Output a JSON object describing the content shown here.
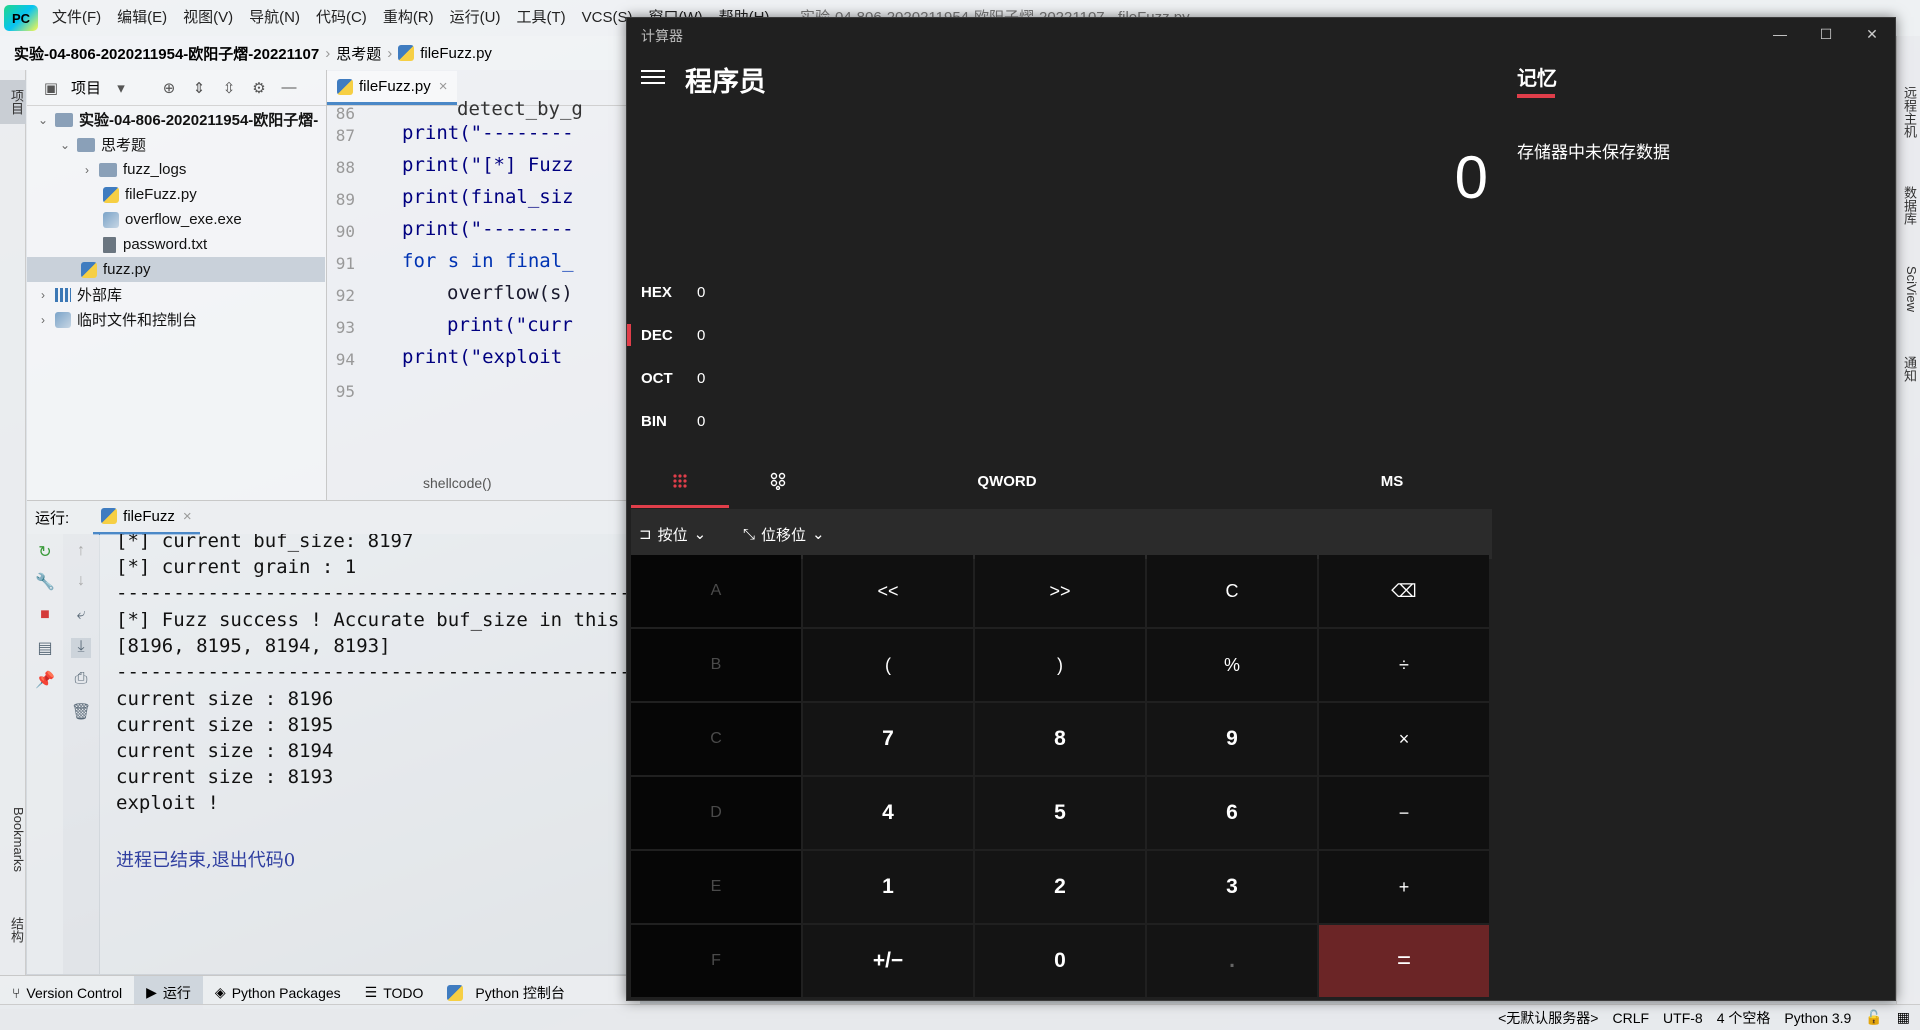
{
  "ide": {
    "logo": "PC",
    "menu": [
      "文件(F)",
      "编辑(E)",
      "视图(V)",
      "导航(N)",
      "代码(C)",
      "重构(R)",
      "运行(U)",
      "工具(T)",
      "VCS(S)",
      "窗口(W)",
      "帮助(H)"
    ],
    "window_title": "实验-04-806-2020211954-欧阳子熠-20221107 - fileFuzz.py",
    "breadcrumb": [
      "实验-04-806-2020211954-欧阳子熠-20221107",
      "思考题",
      "fileFuzz.py"
    ],
    "left_strip": {
      "project": "项目",
      "bookmarks": "Bookmarks",
      "structure": "结构"
    },
    "project_panel": {
      "label": "项目",
      "tree": [
        {
          "label": "实验-04-806-2020211954-欧阳子熠-",
          "type": "root-folder"
        },
        {
          "label": "思考题",
          "type": "folder"
        },
        {
          "label": "fuzz_logs",
          "type": "folder"
        },
        {
          "label": "fileFuzz.py",
          "type": "py"
        },
        {
          "label": "overflow_exe.exe",
          "type": "exe"
        },
        {
          "label": "password.txt",
          "type": "txt"
        },
        {
          "label": "fuzz.py",
          "type": "py"
        },
        {
          "label": "外部库",
          "type": "lib"
        },
        {
          "label": "临时文件和控制台",
          "type": "scratch"
        }
      ]
    },
    "editor": {
      "tab": "fileFuzz.py",
      "lines": [
        {
          "num": "86",
          "code": "detect_by_g"
        },
        {
          "num": "87",
          "code": "print(\"--------"
        },
        {
          "num": "88",
          "code": "print(\"[*] Fuzz"
        },
        {
          "num": "89",
          "code": "print(final_siz"
        },
        {
          "num": "90",
          "code": "print(\"--------"
        },
        {
          "num": "91",
          "code": "for s in final_"
        },
        {
          "num": "92",
          "code": "overflow(s)"
        },
        {
          "num": "93",
          "code": "print(\"curr"
        },
        {
          "num": "94",
          "code": "print(\"exploit"
        },
        {
          "num": "95",
          "code": ""
        }
      ],
      "hint": "shellcode()"
    },
    "run": {
      "label": "运行:",
      "tab": "fileFuzz",
      "console": [
        "[*] current buf_size: 8197",
        "[*] current grain   : 1",
        "--------------------------------------------------",
        "[*] Fuzz success ! Accurate buf_size in this ra",
        "[8196, 8195, 8194, 8193]",
        "--------------------------------------------------",
        "current size : 8196",
        "current size : 8195",
        "current size : 8194",
        "current size : 8193",
        "exploit !",
        "",
        "进程已结束,退出代码0"
      ]
    },
    "bottom_tabs": [
      "Version Control",
      "运行",
      "Python Packages",
      "TODO",
      "Python 控制台"
    ],
    "status": [
      "<无默认服务器>",
      "CRLF",
      "UTF-8",
      "4 个空格",
      "Python 3.9"
    ],
    "right_strip": [
      "远程主机",
      "数据库",
      "SciView",
      "通知"
    ]
  },
  "calculator": {
    "window_title": "计算器",
    "mode": "程序员",
    "display": "0",
    "radix": [
      {
        "label": "HEX",
        "value": "0"
      },
      {
        "label": "DEC",
        "value": "0"
      },
      {
        "label": "OCT",
        "value": "0"
      },
      {
        "label": "BIN",
        "value": "0"
      }
    ],
    "word_size": "QWORD",
    "ms_label": "MS",
    "bitwise_label": "按位",
    "bitshift_label": "位移位",
    "keys": [
      [
        "A",
        "<<",
        ">>",
        "C",
        "⌫"
      ],
      [
        "B",
        "(",
        ")",
        "%",
        "÷"
      ],
      [
        "C",
        "7",
        "8",
        "9",
        "×"
      ],
      [
        "D",
        "4",
        "5",
        "6",
        "−"
      ],
      [
        "E",
        "1",
        "2",
        "3",
        "+"
      ],
      [
        "F",
        "+/−",
        "0",
        ".",
        "="
      ]
    ],
    "memory_title": "记忆",
    "memory_empty": "存储器中未保存数据"
  }
}
